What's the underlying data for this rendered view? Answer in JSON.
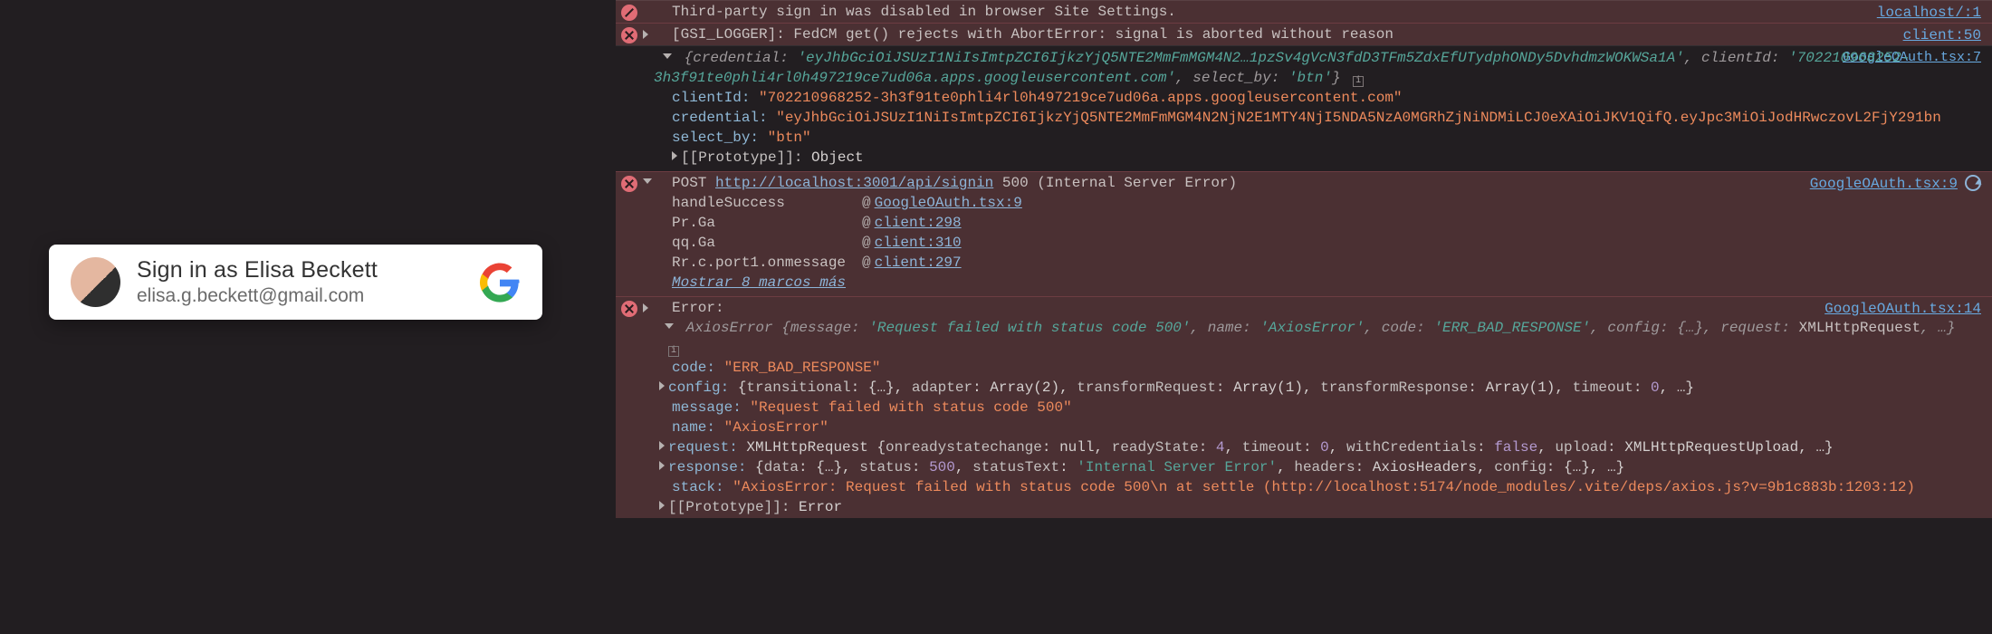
{
  "signin": {
    "title": "Sign in as Elisa Beckett",
    "email": "elisa.g.beckett@gmail.com"
  },
  "msg1": {
    "text": "Third-party sign in was disabled in browser Site Settings.",
    "src": "localhost/:1"
  },
  "msg2": {
    "text": "[GSI_LOGGER]: FedCM get() rejects with AbortError: signal is aborted without reason",
    "src": "client:50"
  },
  "msg3": {
    "src": "GoogleOAuth.tsx:7",
    "headItalic": "{credential: 'eyJhbGciOiJSUzI1NiIsImtpZCI6IjkzYjQ5NTE2MmFmMGM4N2…1pzSv4gVcN3fdD3TFm5ZdxEfUTydphONDy5DvhdmzWOKWSa1A', clientId: '702210968252-3h3f91te0phli4rl0h497219ce7ud06a.apps.googleusercontent.com', select_by: 'btn'}",
    "clientIdK": "clientId",
    "clientIdV": "\"702210968252-3h3f91te0phli4rl0h497219ce7ud06a.apps.googleusercontent.com\"",
    "credK": "credential",
    "credV": "\"eyJhbGciOiJSUzI1NiIsImtpZCI6IjkzYjQ5NTE2MmFmMGM4N2NjN2E1MTY4NjI5NDA5NzA0MGRhZjNiNDMiLCJ0eXAiOiJKV1QifQ.eyJpc3MiOiJodHRwczovL2FjY291bn",
    "selK": "select_by",
    "selV": "\"btn\"",
    "protoK": "[[Prototype]]",
    "protoV": "Object"
  },
  "msg4": {
    "post": "POST",
    "url": "http://localhost:3001/api/signin",
    "status": "500 (Internal Server Error)",
    "src": "GoogleOAuth.tsx:9",
    "rows": [
      {
        "fn": "handleSuccess",
        "at": "@",
        "lk": "GoogleOAuth.tsx:9"
      },
      {
        "fn": "Pr.Ga",
        "at": "@",
        "lk": "client:298"
      },
      {
        "fn": "qq.Ga",
        "at": "@",
        "lk": "client:310"
      },
      {
        "fn": "Rr.c.port1.onmessage",
        "at": "@",
        "lk": "client:297"
      }
    ],
    "more": "Mostrar 8 marcos más"
  },
  "msg5": {
    "src": "GoogleOAuth.tsx:14",
    "head": "Error:",
    "top": "AxiosError {message: 'Request failed with status code 500', name: 'AxiosError', code: 'ERR_BAD_RESPONSE', config: {…}, request: XMLHttpRequest, …}",
    "codeK": "code",
    "codeV": "\"ERR_BAD_RESPONSE\"",
    "cfg": "config: {transitional: {…}, adapter: Array(2), transformRequest: Array(1), transformResponse: Array(1), timeout: 0, …}",
    "msgK": "message",
    "msgV": "\"Request failed with status code 500\"",
    "nameK": "name",
    "nameV": "\"AxiosError\"",
    "req": "request: XMLHttpRequest {onreadystatechange: null, readyState: 4, timeout: 0, withCredentials: false, upload: XMLHttpRequestUpload, …}",
    "resp": "response: {data: {…}, status: 500, statusText: 'Internal Server Error', headers: AxiosHeaders, config: {…}, …}",
    "stkK": "stack",
    "stkV": "\"AxiosError: Request failed with status code 500\\n    at settle (http://localhost:5174/node_modules/.vite/deps/axios.js?v=9b1c883b:1203:12)",
    "protoK": "[[Prototype]]",
    "protoV": "Error"
  }
}
